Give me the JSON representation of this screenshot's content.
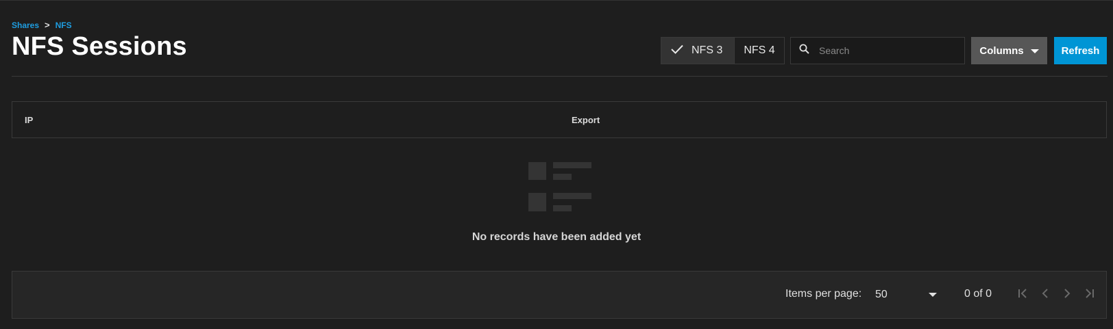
{
  "breadcrumb": {
    "items": [
      "Shares",
      "NFS"
    ],
    "separator": ">"
  },
  "page": {
    "title": "NFS Sessions"
  },
  "toolbar": {
    "toggle_nfs3": "NFS 3",
    "toggle_nfs4": "NFS 4",
    "selected_toggle": "NFS 3",
    "search_placeholder": "Search",
    "columns_label": "Columns",
    "refresh_label": "Refresh"
  },
  "table": {
    "columns": [
      "IP",
      "Export"
    ],
    "rows": [],
    "empty_message": "No records have been added yet"
  },
  "paginator": {
    "items_per_page_label": "Items per page:",
    "items_per_page_value": "50",
    "range_label": "0 of 0"
  },
  "colors": {
    "background": "#1e1e1e",
    "accent": "#0095d5",
    "link": "#1e9de0",
    "columns_button": "#575757"
  },
  "icons": {
    "check": "check-icon",
    "search": "search-icon",
    "dropdown": "caret-down-icon",
    "empty": "empty-list-icon",
    "first": "first-page-icon",
    "previous": "previous-page-icon",
    "next": "next-page-icon",
    "last": "last-page-icon"
  }
}
